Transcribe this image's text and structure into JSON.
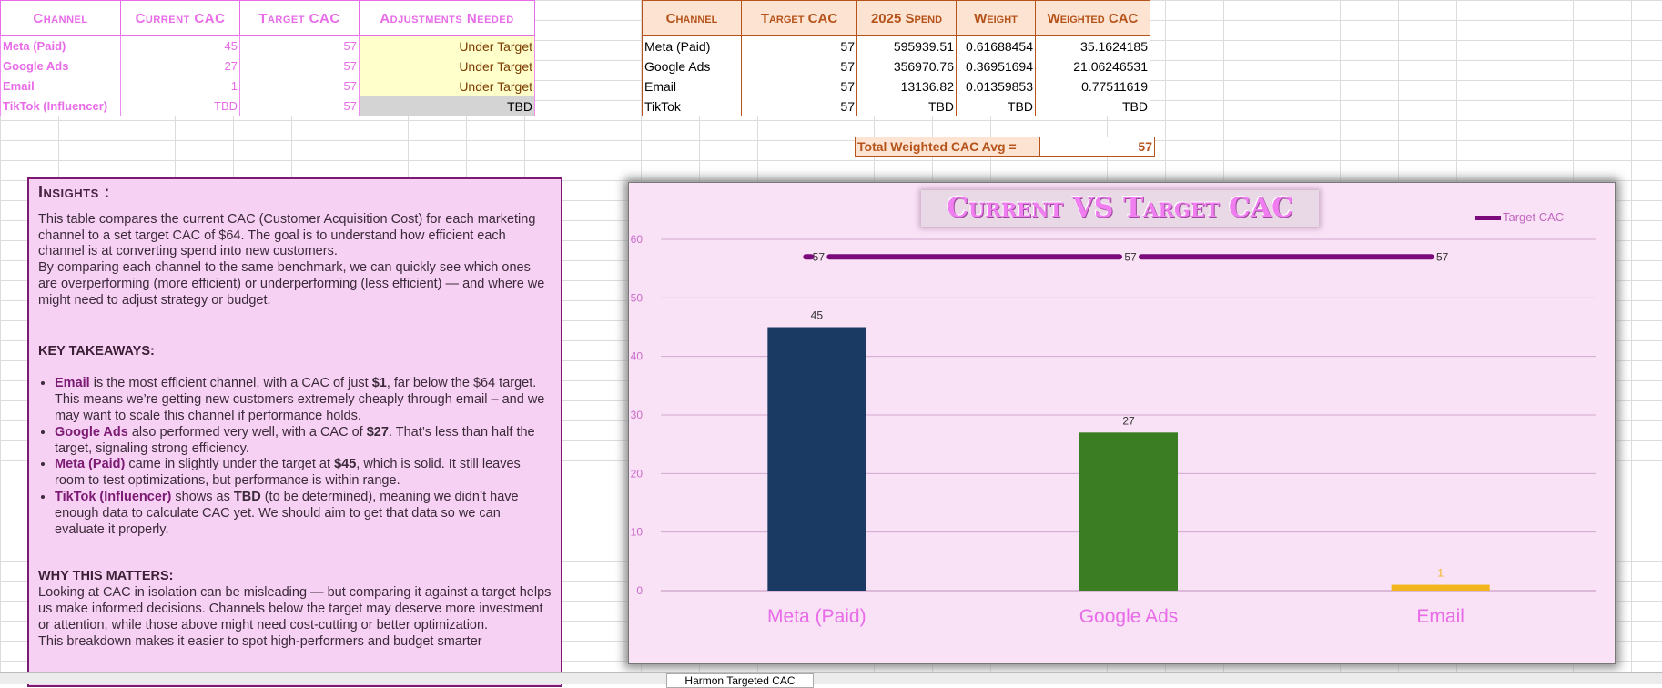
{
  "table1": {
    "headers": [
      "Channel",
      "Current CAC",
      "Target CAC",
      "Adjustments Needed"
    ],
    "rows": [
      {
        "channel": "Meta (Paid)",
        "current": "45",
        "target": "57",
        "adjust": "Under Target"
      },
      {
        "channel": "Google Ads",
        "current": "27",
        "target": "57",
        "adjust": "Under Target"
      },
      {
        "channel": "Email",
        "current": "1",
        "target": "57",
        "adjust": "Under Target"
      },
      {
        "channel": "TikTok (Influencer)",
        "current": "TBD",
        "target": "57",
        "adjust": "TBD"
      }
    ]
  },
  "table2": {
    "headers": [
      "Channel",
      "Target CAC",
      "2025 Spend",
      "Weight",
      "Weighted CAC"
    ],
    "rows": [
      {
        "channel": "Meta (Paid)",
        "target": "57",
        "spend": "595939.51",
        "weight": "0.61688454",
        "weighted": "35.1624185"
      },
      {
        "channel": "Google Ads",
        "target": "57",
        "spend": "356970.76",
        "weight": "0.36951694",
        "weighted": "21.06246531"
      },
      {
        "channel": "Email",
        "target": "57",
        "spend": "13136.82",
        "weight": "0.01359853",
        "weighted": "0.77511619"
      },
      {
        "channel": "TikTok",
        "target": "57",
        "spend": "TBD",
        "weight": "TBD",
        "weighted": "TBD"
      }
    ],
    "total_label": "Total Weighted CAC Avg =",
    "total_value": "57"
  },
  "insights": {
    "title": "Insights :",
    "intro1": "This table compares the current CAC (Customer Acquisition Cost) for each marketing channel to a set target CAC of $64. The goal is to understand how efficient each channel is at converting spend into new customers.",
    "intro2": "By comparing each channel to the same benchmark, we can quickly see which ones are overperforming (more efficient) or underperforming (less efficient) — and where we might need to adjust strategy or budget.",
    "takeaways_title": "KEY TAKEAWAYS:",
    "takeaways": [
      {
        "name": "Email",
        "a": " is the most efficient channel, with a CAC of just ",
        "val": "$1",
        "b": ", far below the $64 target. This means we’re getting new customers extremely cheaply through email – and we may want to scale this channel if performance holds."
      },
      {
        "name": "Google Ads",
        "a": " also performed very well, with a CAC of ",
        "val": "$27",
        "b": ". That’s less than half the target, signaling strong efficiency."
      },
      {
        "name": "Meta (Paid)",
        "a": " came in slightly under the target at ",
        "val": "$45",
        "b": ", which is solid. It still leaves room to test optimizations, but performance is within range."
      },
      {
        "name": "TikTok (Influencer)",
        "a": " shows as ",
        "val": "TBD",
        "b": " (to be determined), meaning we didn’t have enough data to calculate CAC yet. We should aim to get that data so we can evaluate it properly."
      }
    ],
    "why_title": "WHY THIS MATTERS:",
    "why_text": "Looking at CAC in isolation can be misleading — but comparing it against a target helps us make informed decisions. Channels below the target may deserve more investment or attention, while those above might need cost-cutting or better optimization.",
    "closing": "This breakdown makes it easier to spot high-performers and budget smarter"
  },
  "sheet_tab": "Harmon Targeted CAC",
  "chart_data": {
    "type": "bar",
    "title": "Current VS Target CAC",
    "categories": [
      "Meta (Paid)",
      "Google Ads",
      "Email"
    ],
    "series": [
      {
        "name": "Current CAC",
        "values": [
          45,
          27,
          1
        ],
        "colors": [
          "#1b3a63",
          "#3b7d22",
          "#f2b61c"
        ]
      },
      {
        "name": "Target CAC",
        "values": [
          57,
          57,
          57
        ],
        "color": "#7b0a7b",
        "kind": "line"
      }
    ],
    "legend": [
      "Target CAC"
    ],
    "legend_position": "top-right",
    "ylim": [
      0,
      60
    ],
    "yticks": [
      0,
      10,
      20,
      30,
      40,
      50,
      60
    ],
    "grid": true
  }
}
